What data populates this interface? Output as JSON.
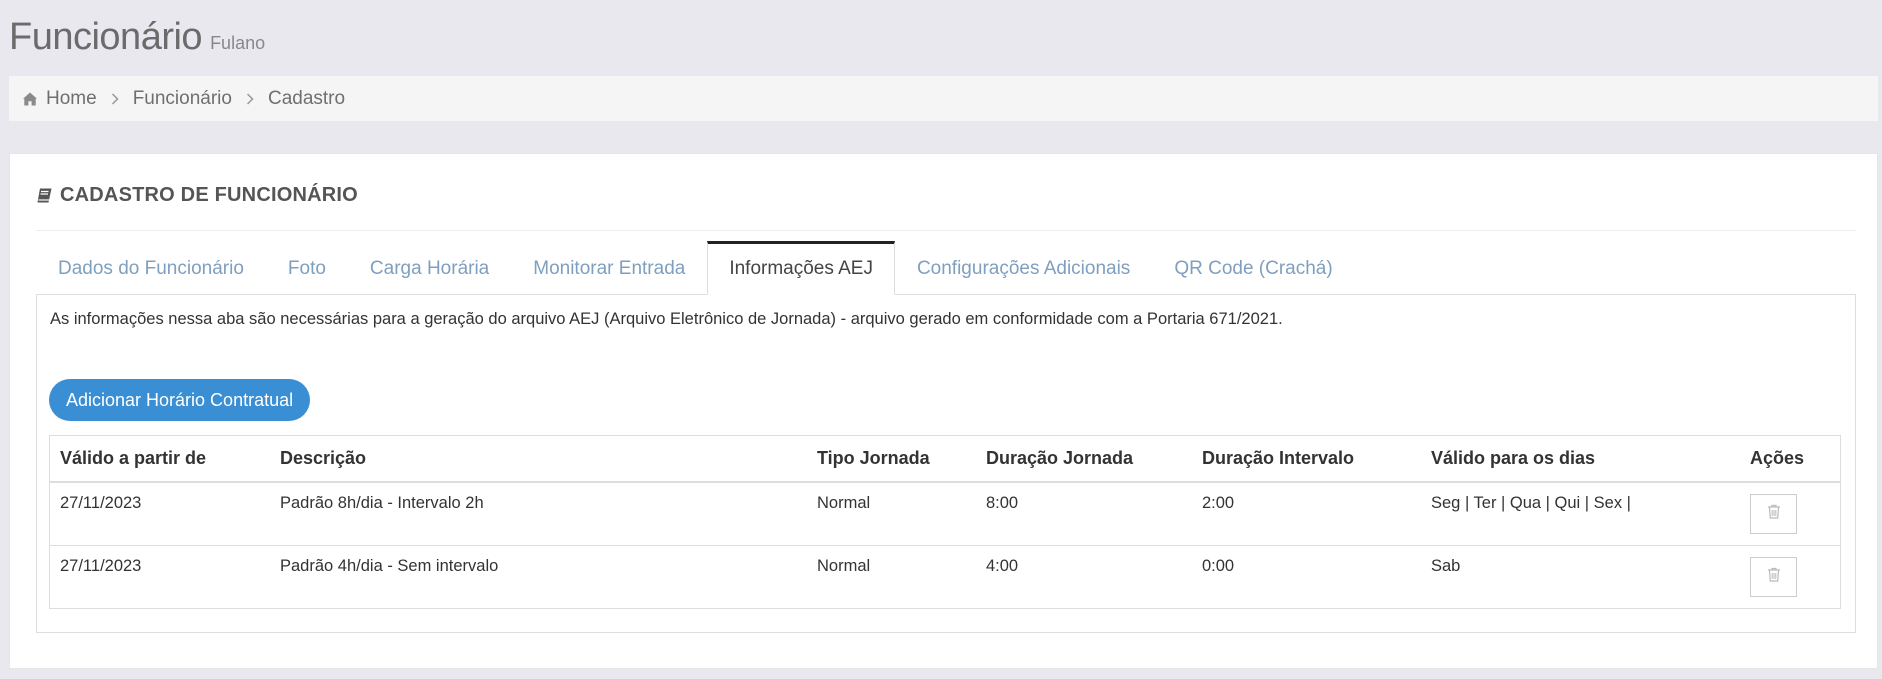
{
  "header": {
    "title": "Funcionário",
    "subtitle": "Fulano"
  },
  "breadcrumb": {
    "items": [
      "Home",
      "Funcionário",
      "Cadastro"
    ]
  },
  "panel": {
    "title": "CADASTRO DE FUNCIONÁRIO"
  },
  "tabs": [
    {
      "label": "Dados do Funcionário",
      "active": false
    },
    {
      "label": "Foto",
      "active": false
    },
    {
      "label": "Carga Horária",
      "active": false
    },
    {
      "label": "Monitorar Entrada",
      "active": false
    },
    {
      "label": "Informações AEJ",
      "active": true
    },
    {
      "label": "Configurações Adicionais",
      "active": false
    },
    {
      "label": "QR Code (Crachá)",
      "active": false
    }
  ],
  "content": {
    "intro": "As informações nessa aba são necessárias para a geração do arquivo AEJ (Arquivo Eletrônico de Jornada) - arquivo gerado em conformidade com a Portaria 671/2021.",
    "add_button_label": "Adicionar Horário Contratual"
  },
  "table": {
    "columns": [
      "Válido a partir de",
      "Descrição",
      "Tipo Jornada",
      "Duração Jornada",
      "Duração Intervalo",
      "Válido para os dias",
      "Ações"
    ],
    "rows": [
      [
        "27/11/2023",
        "Padrão 8h/dia - Intervalo 2h",
        "Normal",
        "8:00",
        "2:00",
        "Seg | Ter | Qua | Qui | Sex |"
      ],
      [
        "27/11/2023",
        "Padrão 4h/dia - Sem intervalo",
        "Normal",
        "4:00",
        "0:00",
        "Sab"
      ]
    ]
  },
  "icons": {
    "home": "home-icon",
    "separator": "chevron-right-icon",
    "panel": "book-icon",
    "delete": "trash-icon"
  },
  "colors": {
    "accent": "#3a8fd4",
    "tab_inactive": "#7f9fbf",
    "background": "#e9e8ee"
  }
}
